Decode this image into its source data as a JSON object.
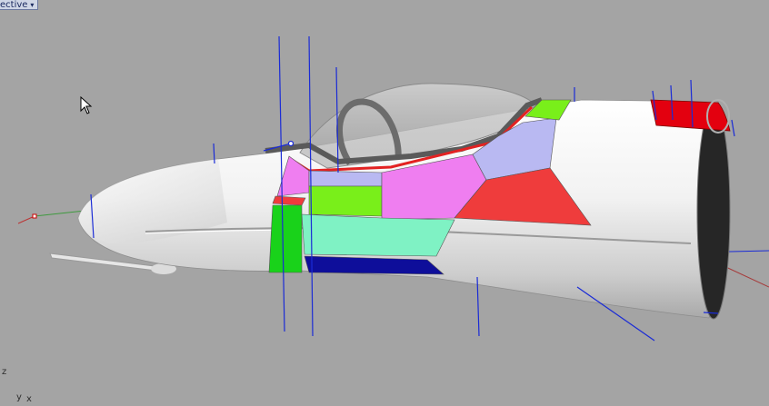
{
  "viewport": {
    "title": "ective",
    "menu_caret": "▾"
  },
  "axes": {
    "z": "z",
    "y": "y",
    "x": "x"
  },
  "colors": {
    "background": "#a4a4a4",
    "fuselage": "#f4f4f4",
    "magenta_panel": "#ef7ef0",
    "lime_panel": "#79ef1a",
    "green_band": "#19d21a",
    "mint_panel": "#7ff2c4",
    "navy_panel": "#0e0e9a",
    "lavender_panel": "#b9b9f2",
    "red_panel": "#ef3c3c",
    "exhaust_red": "#e3000f",
    "control_lines": "#1a2bd6"
  }
}
